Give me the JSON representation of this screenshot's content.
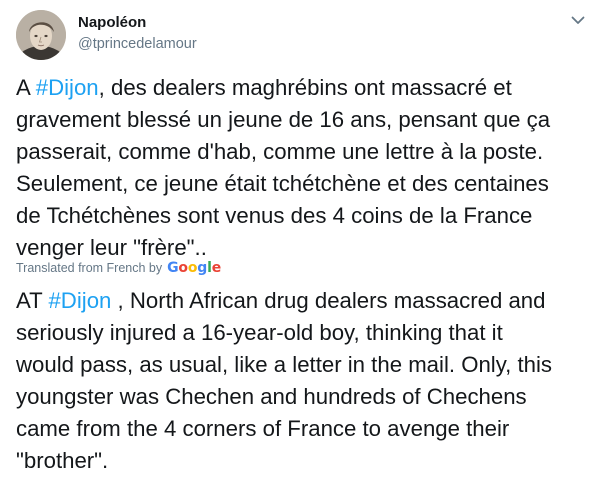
{
  "author": {
    "name": "Napoléon",
    "handle": "@tprincedelamour"
  },
  "original": {
    "prefix": "A ",
    "hashtag": "#Dijon",
    "text": ", des dealers maghrébins ont massacré et\ngravement blessé un jeune de 16 ans, pensant que ça\npasserait, comme d'hab, comme une lettre à la poste.\nSeulement, ce jeune était tchétchène et des centaines\nde Tchétchènes sont venus des 4 coins de la France\nvenger leur \"frère\".."
  },
  "translation_note": {
    "label": "Translated from French by",
    "provider": "Google"
  },
  "translated": {
    "prefix": "AT ",
    "hashtag": "#Dijon",
    "text": " , North African drug dealers massacred and\nseriously injured a 16-year-old boy, thinking that it\nwould pass, as usual, like a letter in the mail. Only, this\nyoungster was Chechen and hundreds of Chechens\ncame from the 4 corners of France to avenge their\n\"brother\"."
  },
  "icons": {
    "avatar": "portrait-avatar",
    "menu": "chevron-down-icon"
  },
  "colors": {
    "hashtag": "#1da1f2",
    "secondary_text": "#657786",
    "text": "#14171a"
  }
}
